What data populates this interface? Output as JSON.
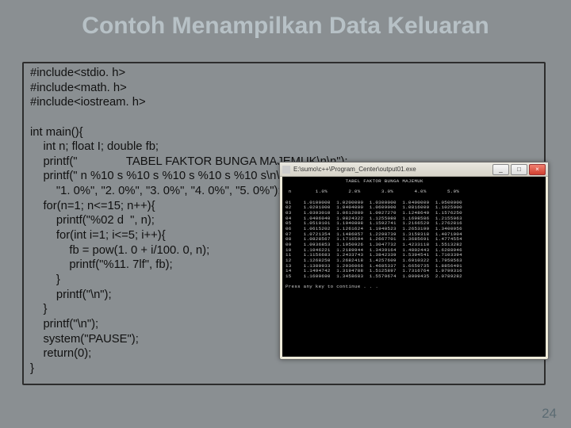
{
  "title": "Contoh Menampilkan Data Keluaran",
  "code": "#include<stdio. h>\n#include<math. h>\n#include<iostream. h>\n\nint main(){\n    int n; float I; double fb;\n    printf(\"               TABEL FAKTOR BUNGA MAJEMUK\\n\\n\");\n    printf(\" n %10 s %10 s %10 s %10 s %10 s\\n\\n\",\n        \"1. 0%\", \"2. 0%\", \"3. 0%\", \"4. 0%\", \"5. 0%\");\n    for(n=1; n<=15; n++){\n        printf(\"%02 d  \", n);\n        for(int i=1; i<=5; i++){\n            fb = pow(1. 0 + i/100. 0, n);\n            printf(\"%11. 7lf\", fb);\n        }\n        printf(\"\\n\");\n    }\n    printf(\"\\n\");\n    system(\"PAUSE\");\n    return(0);\n}",
  "console": {
    "path": "E:\\sumo\\c++\\Program_Center\\output01.exe",
    "min": "_",
    "max": "□",
    "close": "×"
  },
  "pagenum": "24",
  "chart_data": {
    "type": "table",
    "title": "TABEL FAKTOR BUNGA MAJEMUK",
    "columns": [
      "n",
      "1.0%",
      "2.0%",
      "3.0%",
      "4.0%",
      "5.0%"
    ],
    "rows": [
      [
        1,
        1.01,
        1.02,
        1.03,
        1.04,
        1.05
      ],
      [
        2,
        1.0201,
        1.0404,
        1.0609,
        1.0816,
        1.1025
      ],
      [
        3,
        1.030301,
        1.061208,
        1.092727,
        1.124864,
        1.157625
      ],
      [
        4,
        1.040604,
        1.0824322,
        1.1255088,
        1.1698586,
        1.2155063
      ],
      [
        5,
        1.0510101,
        1.1040808,
        1.1592741,
        1.2166529,
        1.2762816
      ],
      [
        6,
        1.0615202,
        1.1261624,
        1.1940523,
        1.265319,
        1.3400956
      ],
      [
        7,
        1.0721354,
        1.1486857,
        1.2298739,
        1.3159318,
        1.4071004
      ],
      [
        8,
        1.0828567,
        1.1716594,
        1.2667701,
        1.3685691,
        1.4774554
      ],
      [
        9,
        1.0936853,
        1.1950926,
        1.3047732,
        1.4233118,
        1.5513282
      ],
      [
        10,
        1.1046221,
        1.2189944,
        1.3439164,
        1.4802443,
        1.6288946
      ],
      [
        11,
        1.1156683,
        1.2433743,
        1.3842339,
        1.5394541,
        1.7103394
      ],
      [
        12,
        1.126825,
        1.2682418,
        1.4257609,
        1.6010322,
        1.7958563
      ],
      [
        13,
        1.1380933,
        1.2936066,
        1.4685337,
        1.6650735,
        1.8856491
      ],
      [
        14,
        1.1494742,
        1.3194788,
        1.5125897,
        1.7316764,
        1.9799316
      ],
      [
        15,
        1.160969,
        1.3458683,
        1.5579674,
        1.8009435,
        2.0789282
      ]
    ],
    "footer": "Press any key to continue . . ."
  }
}
